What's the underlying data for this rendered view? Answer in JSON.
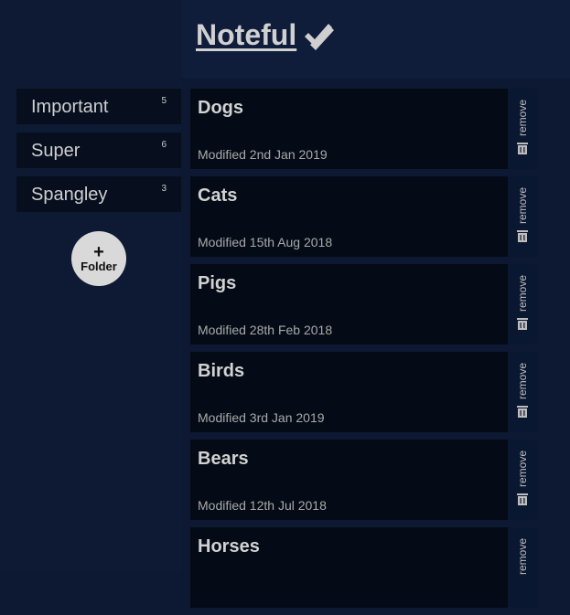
{
  "app": {
    "title": "Noteful"
  },
  "folders": [
    {
      "name": "Important",
      "count": "5"
    },
    {
      "name": "Super",
      "count": "6"
    },
    {
      "name": "Spangley",
      "count": "3"
    }
  ],
  "add_folder": {
    "plus": "+",
    "label": "Folder"
  },
  "notes": [
    {
      "title": "Dogs",
      "modified": "Modified 2nd Jan 2019",
      "remove_label": "remove"
    },
    {
      "title": "Cats",
      "modified": "Modified 15th Aug 2018",
      "remove_label": "remove"
    },
    {
      "title": "Pigs",
      "modified": "Modified 28th Feb 2018",
      "remove_label": "remove"
    },
    {
      "title": "Birds",
      "modified": "Modified 3rd Jan 2019",
      "remove_label": "remove"
    },
    {
      "title": "Bears",
      "modified": "Modified 12th Jul 2018",
      "remove_label": "remove"
    },
    {
      "title": "Horses",
      "modified": "",
      "remove_label": "remove"
    }
  ],
  "icons": {
    "logo": "double-check-icon",
    "remove": "trash-icon"
  },
  "colors": {
    "background": "#0d1933",
    "panel": "#040b16",
    "accent": "#d9d9d9"
  }
}
